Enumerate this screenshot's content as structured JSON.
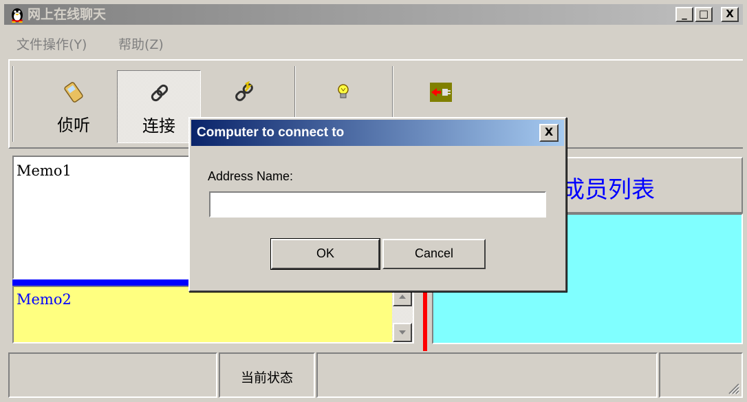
{
  "window": {
    "title": "网上在线聊天",
    "icon": "penguin-icon",
    "minimize_label": "_",
    "maximize_label": "□",
    "close_label": "X"
  },
  "menu": [
    {
      "label": "文件操作(Y)"
    },
    {
      "label": "帮助(Z)"
    }
  ],
  "toolbar": [
    {
      "label": "侦听",
      "icon": "phone-icon"
    },
    {
      "label": "连接",
      "icon": "chain-link-icon"
    },
    {
      "label": "",
      "icon": "disconnect-link-icon"
    },
    {
      "label": "",
      "icon": "lightbulb-icon"
    },
    {
      "label": "",
      "icon": "plug-exit-icon"
    }
  ],
  "memo1": {
    "text": "Memo1"
  },
  "memo2": {
    "text": "Memo2"
  },
  "member_panel": {
    "header": "讨论成员列表"
  },
  "statusbar": {
    "panels": [
      "",
      "当前状态",
      "",
      ""
    ]
  },
  "dialog": {
    "title": "Computer to connect to",
    "close_label": "X",
    "address_label": "Address Name:",
    "address_value": "",
    "ok_label": "OK",
    "cancel_label": "Cancel"
  },
  "colors": {
    "memo2_background": "#ffff80",
    "member_list_background": "#80ffff",
    "member_header_text": "#0000ff",
    "splitter_horizontal": "#0000ff",
    "splitter_vertical": "#ff0000",
    "dialog_title_start": "#0a246a",
    "dialog_title_end": "#a6caf0"
  }
}
